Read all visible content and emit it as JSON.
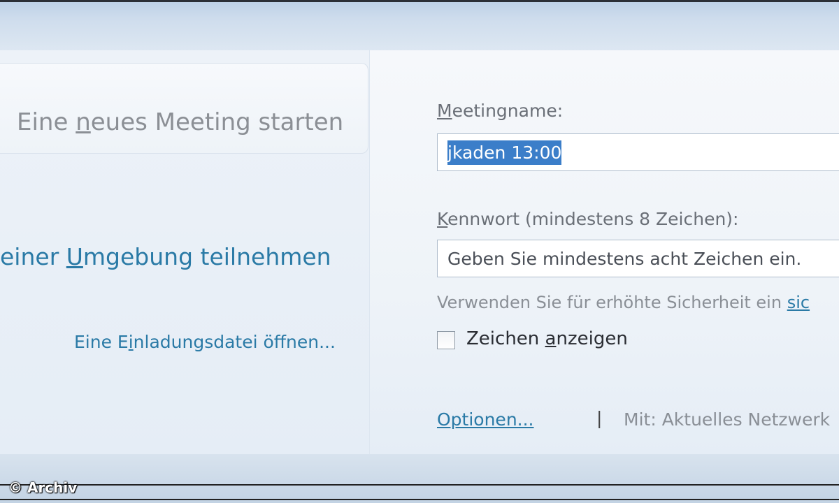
{
  "left": {
    "start_meeting_pre": "Eine ",
    "start_meeting_key": "n",
    "start_meeting_post": "eues Meeting starten",
    "join_pre": "einer ",
    "join_key": "U",
    "join_post": "mgebung teilnehmen",
    "invite_pre": "Eine E",
    "invite_key": "i",
    "invite_post": "nladungsdatei öffnen..."
  },
  "form": {
    "meeting_name_key": "M",
    "meeting_name_label_rest": "eetingname:",
    "meeting_name_value": "jkaden 13:00",
    "password_key": "K",
    "password_label_rest": "ennwort (mindestens 8 Zeichen):",
    "password_placeholder": "Geben Sie mindestens acht Zeichen ein.",
    "security_hint": "Verwenden Sie für erhöhte Sicherheit ein ",
    "security_hint_link": "sic",
    "show_chars_pre": "Zeichen ",
    "show_chars_key": "a",
    "show_chars_post": "nzeigen",
    "show_chars_checked": false
  },
  "footer": {
    "options_link": "Optionen...",
    "separator": "|",
    "network_text": "Mit: Aktuelles Netzwerk"
  },
  "watermark": "© Archiv",
  "colors": {
    "link": "#2a7aa6",
    "selection": "#3b7ec9",
    "muted_text": "#8a8f96"
  }
}
